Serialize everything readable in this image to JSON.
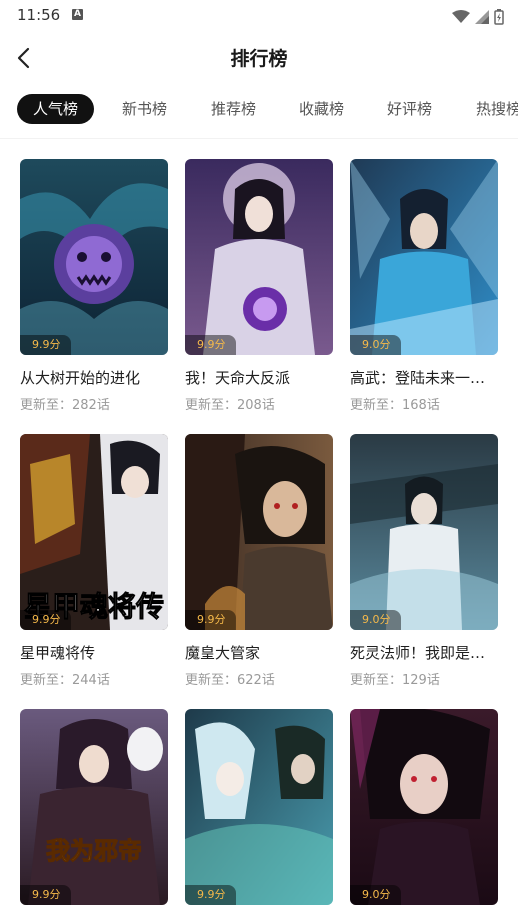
{
  "status_bar": {
    "time": "11:56",
    "notification_badge": "A"
  },
  "header": {
    "title": "排行榜"
  },
  "tabs": [
    {
      "label": "人气榜",
      "active": true
    },
    {
      "label": "新书榜",
      "active": false
    },
    {
      "label": "推荐榜",
      "active": false
    },
    {
      "label": "收藏榜",
      "active": false
    },
    {
      "label": "好评榜",
      "active": false
    },
    {
      "label": "热搜榜",
      "active": false
    }
  ],
  "update_prefix": "更新至：",
  "books": [
    {
      "title": "从大树开始的进化",
      "score": "9.9分",
      "updated": "282话"
    },
    {
      "title": "我！天命大反派",
      "score": "9.9分",
      "updated": "208话"
    },
    {
      "title": "高武：登陆未来一…",
      "score": "9.0分",
      "updated": "168话"
    },
    {
      "title": "星甲魂将传",
      "score": "9.9分",
      "updated": "244话",
      "cover_text": "星甲魂将传"
    },
    {
      "title": "魔皇大管家",
      "score": "9.9分",
      "updated": "622话"
    },
    {
      "title": "死灵法师！我即是…",
      "score": "9.0分",
      "updated": "129话"
    },
    {
      "title": "",
      "score": "9.9分",
      "updated": "",
      "cover_text": "我为邪帝"
    },
    {
      "title": "",
      "score": "9.9分",
      "updated": ""
    },
    {
      "title": "",
      "score": "9.0分",
      "updated": ""
    }
  ],
  "colors": {
    "accent": "#111111",
    "score": "#f5b94a",
    "muted": "#9a9a9a"
  }
}
